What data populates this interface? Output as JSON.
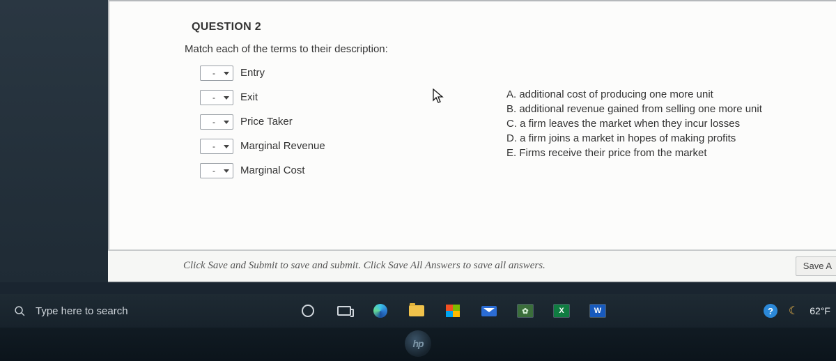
{
  "question": {
    "header": "QUESTION 2",
    "instruction": "Match each of the terms to their description:",
    "terms": [
      {
        "label": "Entry",
        "selected": "-"
      },
      {
        "label": "Exit",
        "selected": "-"
      },
      {
        "label": "Price Taker",
        "selected": "-"
      },
      {
        "label": "Marginal Revenue",
        "selected": "-"
      },
      {
        "label": "Marginal Cost",
        "selected": "-"
      }
    ],
    "descriptions": [
      "A. additional cost of producing one more unit",
      "B. additional revenue gained from selling one more unit",
      "C. a firm leaves the market when they incur losses",
      "D. a firm joins a market in hopes of making profits",
      "E. Firms receive their price from the market"
    ]
  },
  "footer": {
    "hint": "Click Save and Submit to save and submit. Click Save All Answers to save all answers.",
    "save_label": "Save A"
  },
  "taskbar": {
    "search_placeholder": "Type here to search",
    "apps": {
      "excel": "X",
      "word": "W"
    },
    "tray": {
      "help": "?",
      "temperature": "62°F"
    }
  },
  "hp": "hp"
}
